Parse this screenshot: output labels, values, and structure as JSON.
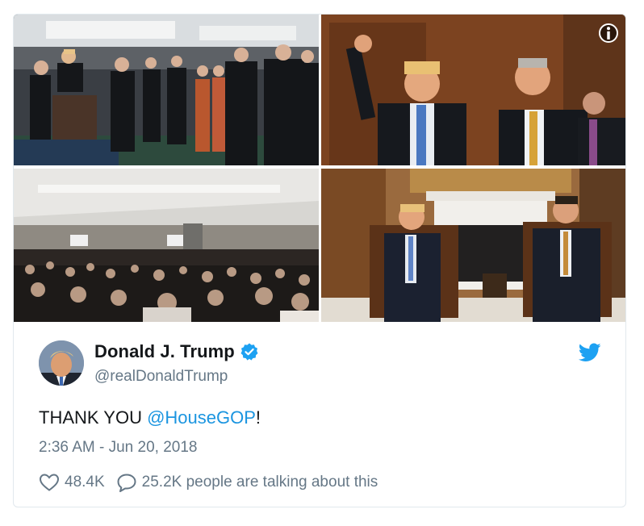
{
  "tweet": {
    "author_name": "Donald J. Trump",
    "handle": "@realDonaldTrump",
    "text_before": "THANK YOU ",
    "mention": "@HouseGOP",
    "text_after": "!",
    "timestamp": "2:36 AM - Jun 20, 2018",
    "likes": "48.4K",
    "talking": "25.2K people are talking about this"
  },
  "colors": {
    "link": "#1b95e0",
    "muted": "#657786",
    "verified": "#1da1f2"
  },
  "icons": {
    "info": "info-icon",
    "verified": "verified-badge-icon",
    "brand": "twitter-bird-icon",
    "like": "heart-icon",
    "reply": "speech-bubble-icon"
  }
}
